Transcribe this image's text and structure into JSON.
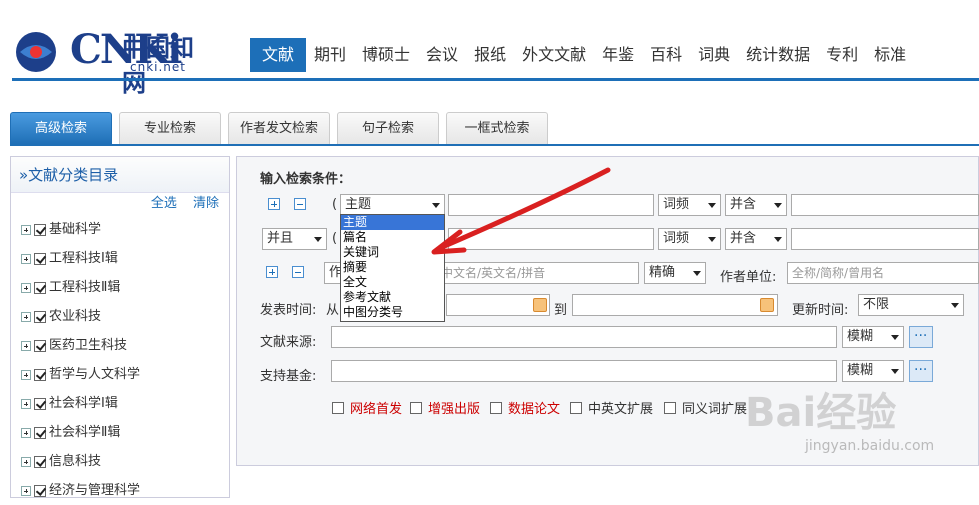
{
  "logo": {
    "mark": "CNKi",
    "cn": "中国知网",
    "url": "cnki.net"
  },
  "nav": [
    "文献",
    "期刊",
    "博硕士",
    "会议",
    "报纸",
    "外文文献",
    "年鉴",
    "百科",
    "词典",
    "统计数据",
    "专利",
    "标准"
  ],
  "tabs": [
    "高级检索",
    "专业检索",
    "作者发文检索",
    "句子检索",
    "一框式检索"
  ],
  "sidebar": {
    "title": "»文献分类目录",
    "select_all": "全选",
    "clear": "清除",
    "items": [
      "基础科学",
      "工程科技Ⅰ辑",
      "工程科技Ⅱ辑",
      "农业科技",
      "医药卫生科技",
      "哲学与人文科学",
      "社会科学Ⅰ辑",
      "社会科学Ⅱ辑",
      "信息科技",
      "经济与管理科学"
    ]
  },
  "form": {
    "heading": "输入检索条件：",
    "paren": "(",
    "row1": {
      "field": "主题",
      "freq": "词频",
      "logic": "并含"
    },
    "row2": {
      "op": "并且",
      "freq": "词频",
      "logic": "并含"
    },
    "author_row": {
      "field_prefix": "作",
      "name_placeholder": "中文名/英文名/拼音",
      "match": "精确",
      "unit_label": "作者单位:",
      "unit_placeholder": "全称/简称/曾用名"
    },
    "time_label": "发表时间:",
    "time_from": "从",
    "time_to": "到",
    "update_label": "更新时间:",
    "update_value": "不限",
    "source_label": "文献来源:",
    "source_match": "模糊",
    "fund_label": "支持基金:",
    "fund_match": "模糊",
    "options": [
      "网络首发",
      "增强出版",
      "数据论文",
      "中英文扩展",
      "同义词扩展"
    ]
  },
  "dropdown": [
    "主题",
    "篇名",
    "关键词",
    "摘要",
    "全文",
    "参考文献",
    "中图分类号"
  ],
  "watermark": {
    "main": "Bai经验",
    "sub": "jingyan.baidu.com"
  },
  "colors": {
    "accent": "#1d6fb8",
    "arrow": "#d92020"
  }
}
